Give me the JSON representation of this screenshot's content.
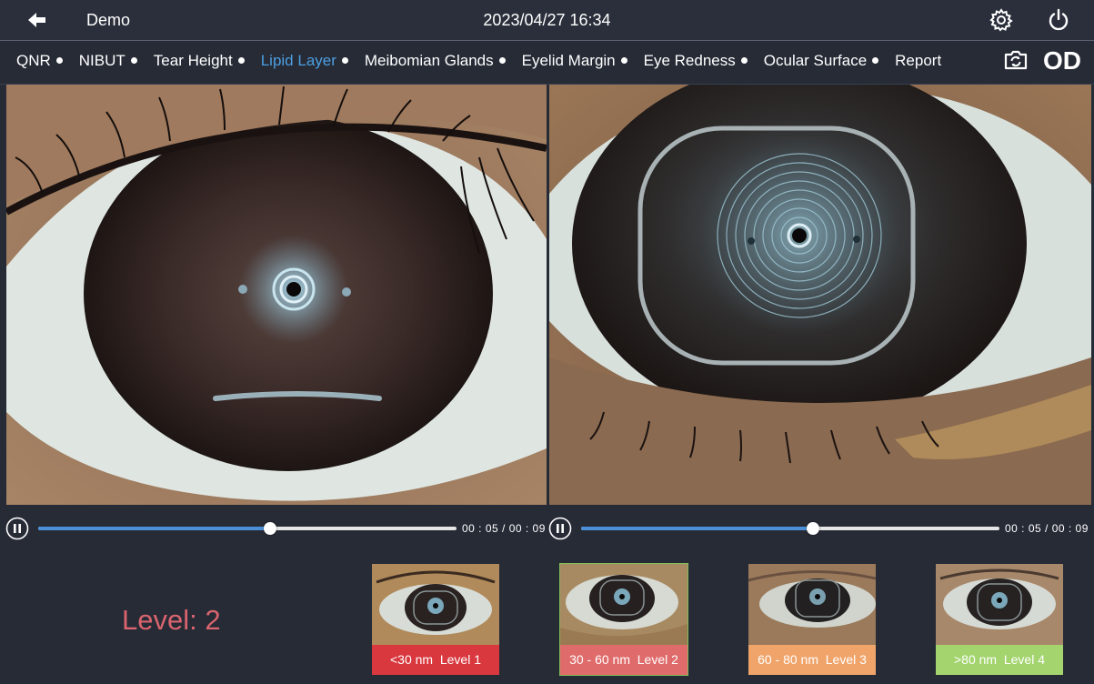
{
  "header": {
    "app_name": "Demo",
    "datetime": "2023/04/27 16:34",
    "icons": [
      "back-arrow-icon",
      "settings-gear-icon",
      "power-icon"
    ]
  },
  "nav": {
    "tabs": [
      {
        "label": "QNR",
        "dot": true,
        "active": false
      },
      {
        "label": "NIBUT",
        "dot": true,
        "active": false
      },
      {
        "label": "Tear Height",
        "dot": true,
        "active": false
      },
      {
        "label": "Lipid Layer",
        "dot": true,
        "active": true
      },
      {
        "label": "Meibomian Glands",
        "dot": true,
        "active": false
      },
      {
        "label": "Eyelid Margin",
        "dot": true,
        "active": false
      },
      {
        "label": "Eye Redness",
        "dot": true,
        "active": false
      },
      {
        "label": "Ocular Surface",
        "dot": true,
        "active": false
      },
      {
        "label": "Report",
        "dot": false,
        "active": false
      }
    ],
    "capture_icon": "camera-switch-icon",
    "eye_side": "OD"
  },
  "players": [
    {
      "time": "00 : 05 / 00 : 09",
      "progress": 0.555
    },
    {
      "time": "00 : 05 / 00 : 09",
      "progress": 0.555
    }
  ],
  "result": {
    "level_text": "Level: 2"
  },
  "references": [
    {
      "label": "<30 nm  Level 1",
      "color": "#d9383f",
      "selected": false
    },
    {
      "label": "30 - 60 nm  Level 2",
      "color": "#e06b6b",
      "selected": true
    },
    {
      "label": "60 - 80 nm  Level 3",
      "color": "#f0a46a",
      "selected": false
    },
    {
      "label": ">80 nm  Level 4",
      "color": "#a3d46e",
      "selected": false
    }
  ],
  "colors": {
    "active_tab": "#4d9fe0",
    "level_text": "#d9646e",
    "progress": "#4a8fd8"
  }
}
